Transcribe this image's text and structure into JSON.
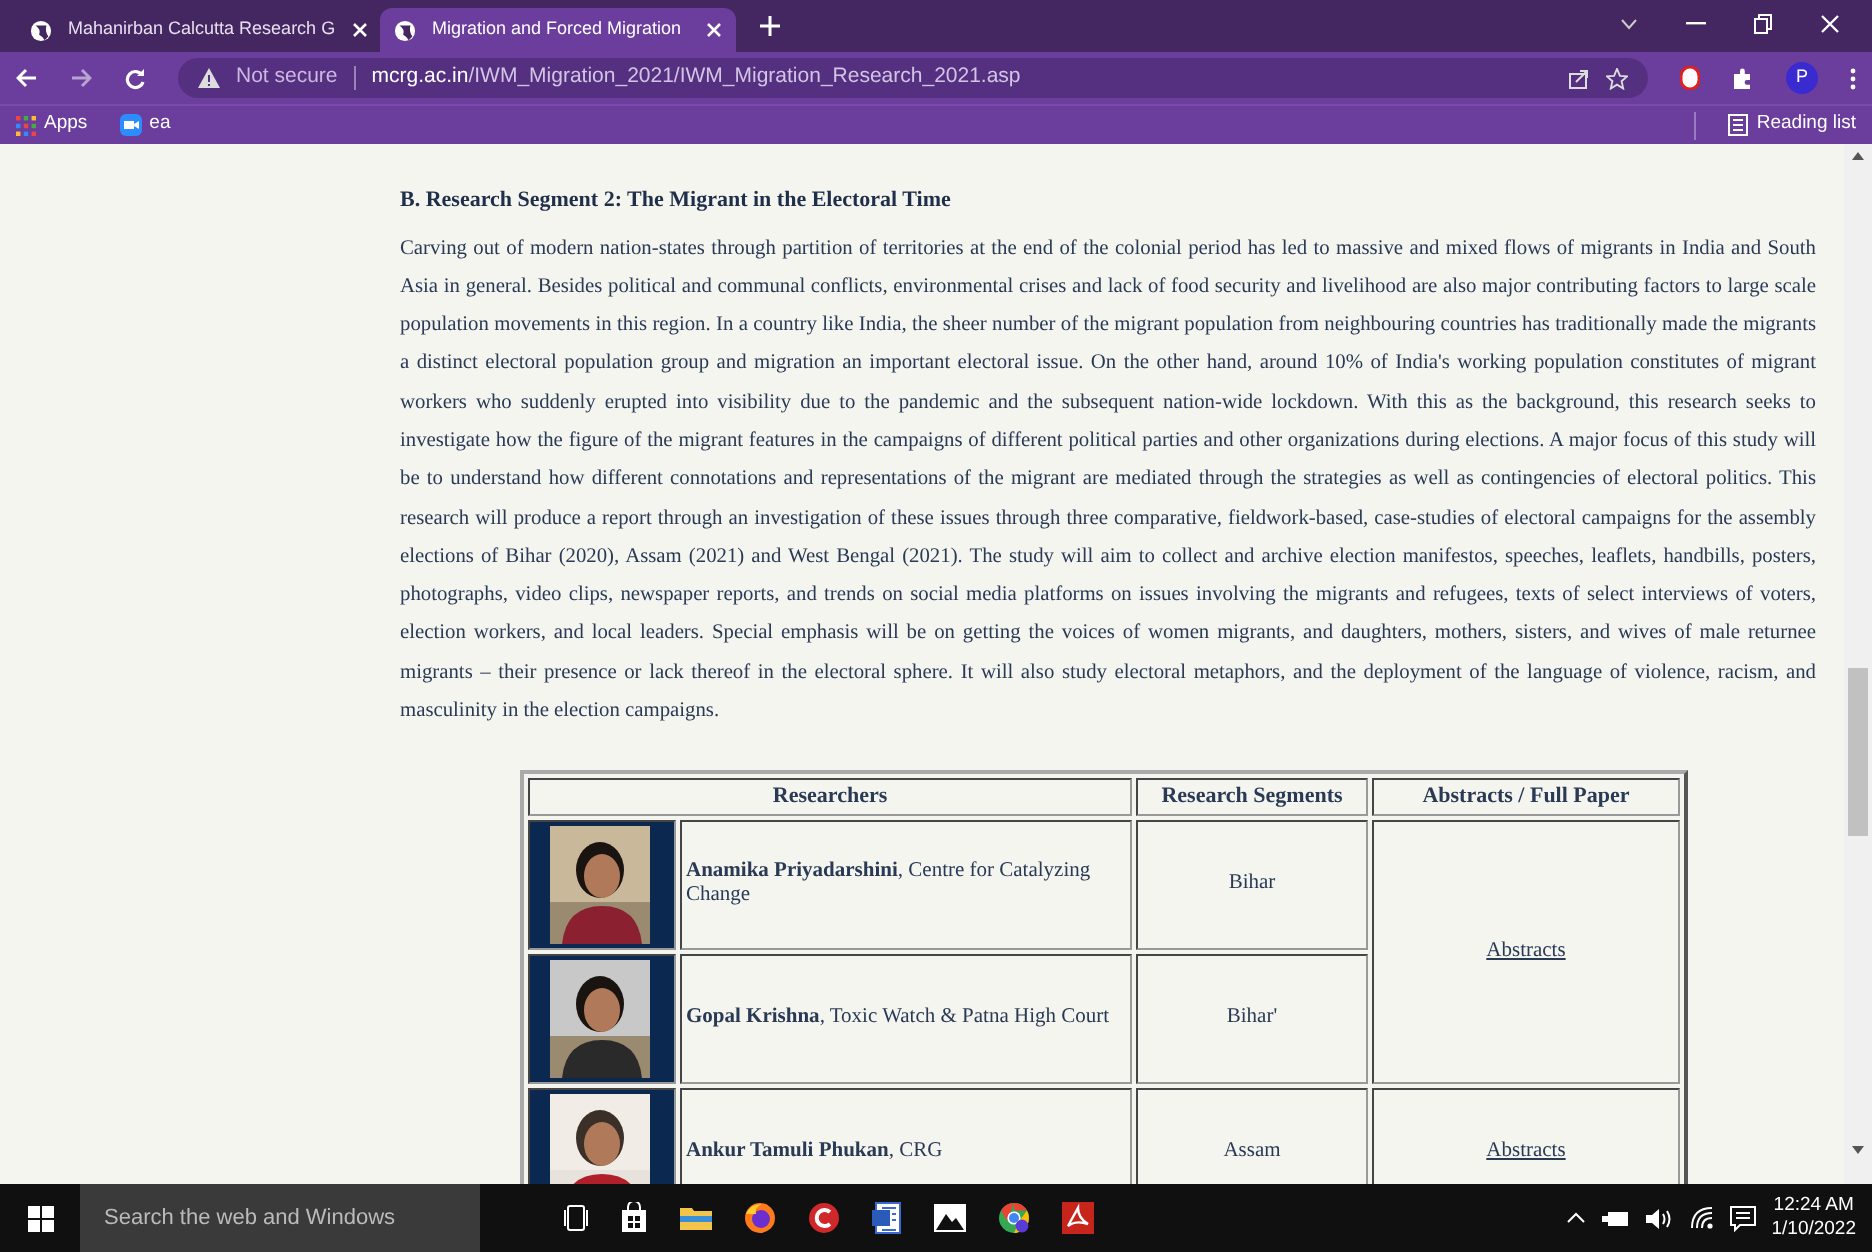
{
  "browser": {
    "tabs": [
      {
        "title": "Mahanirban Calcutta Research G",
        "selected": false
      },
      {
        "title": "Migration and Forced Migration",
        "selected": true
      }
    ],
    "address": {
      "security": "Not secure",
      "domain": "mcrg.ac.in",
      "path": "/IWM_Migration_2021/IWM_Migration_Research_2021.asp"
    },
    "profile": "P",
    "bookmarks": [
      "Apps",
      "ea"
    ],
    "reading_list": "Reading list"
  },
  "page": {
    "heading": "B. Research Segment 2: The Migrant in the Electoral Time",
    "paragraph": "Carving out of modern nation-states through partition of territories at the end of the colonial period has led to massive and mixed flows of migrants in India and South Asia in general. Besides political and communal conflicts, environmental crises and lack of food security and livelihood are also major contributing factors to large scale population movements in this region. In a country like India, the sheer number of the migrant population from neighbouring countries has traditionally made the migrants a distinct electoral population group and migration an important electoral issue. On the other hand, around 10% of India's working population constitutes of migrant workers who suddenly erupted into visibility due to the pandemic and the subsequent nation-wide lockdown. With this as the background, this research seeks to investigate how the figure of the migrant features in the campaigns of different political parties and other organizations during elections. A major focus of this study will be to understand how different connotations and representations of the migrant are mediated through the strategies as well as contingencies of electoral politics. This research will produce a report through an investigation of these issues through three comparative, fieldwork-based, case-studies of electoral campaigns for the assembly elections of Bihar (2020), Assam (2021) and West Bengal (2021). The study will aim to collect and archive election manifestos, speeches, leaflets, handbills, posters, photographs, video clips, newspaper reports, and trends on social media platforms on issues involving the migrants and refugees, texts of select interviews of voters, election workers, and local leaders. Special emphasis will be on getting the voices of women migrants, and daughters, mothers, sisters, and wives of male returnee migrants – their presence or lack thereof in the electoral sphere. It will also study electoral metaphors, and the deployment of the language of violence, racism, and masculinity in the election campaigns.",
    "table": {
      "columns": [
        "Researchers",
        "Research Segments",
        "Abstracts / Full Paper"
      ],
      "groups": [
        {
          "abstract": "Abstracts",
          "rows": [
            {
              "researcher": "**Anamika Priyadarshini**, Centre for Catalyzing Change",
              "segment": "Bihar"
            },
            {
              "researcher": "**Gopal Krishna**, Toxic Watch & Patna High Court",
              "segment": "Bihar'"
            }
          ]
        },
        {
          "abstract": "Abstracts",
          "rows": [
            {
              "researcher": "**Ankur Tamuli Phukan**, CRG",
              "segment": "Assam"
            }
          ]
        }
      ]
    }
  },
  "taskbar": {
    "search_placeholder": "Search the web and Windows",
    "time": "12:24 AM",
    "date": "1/10/2022"
  }
}
